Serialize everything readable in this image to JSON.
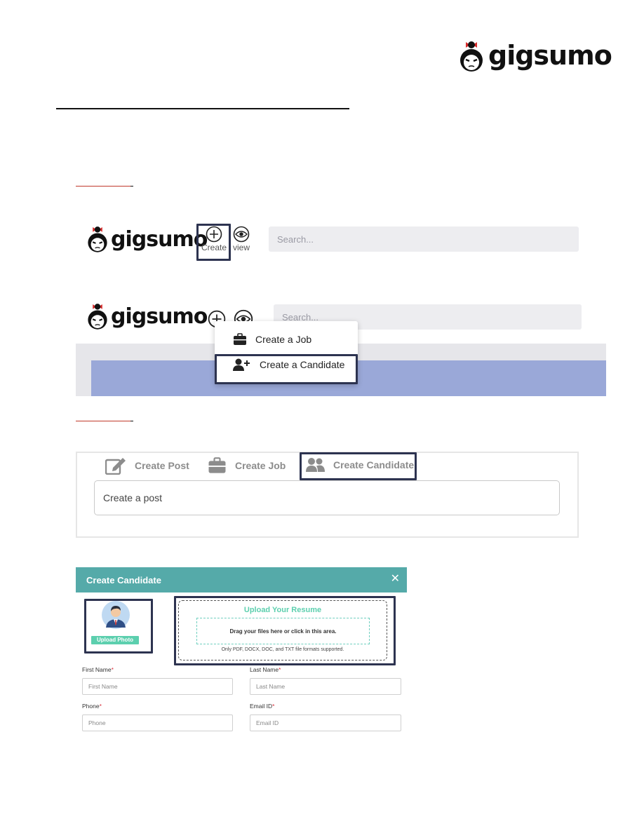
{
  "brand": {
    "name": "gigsumo"
  },
  "screen1": {
    "create_label": "Create",
    "view_label": "view",
    "search_placeholder": "Search..."
  },
  "screen2": {
    "search_placeholder": "Search...",
    "menu": [
      {
        "label": "Create a Job",
        "icon": "briefcase-icon"
      },
      {
        "label": "Create a Candidate",
        "icon": "user-plus-icon"
      }
    ]
  },
  "screen3": {
    "tabs": [
      {
        "label": "Create Post",
        "icon": "edit-icon"
      },
      {
        "label": "Create Job",
        "icon": "briefcase-icon"
      },
      {
        "label": "Create Candidate",
        "icon": "users-icon"
      }
    ],
    "post_placeholder": "Create a post"
  },
  "screen4": {
    "title": "Create Candidate",
    "close": "✕",
    "upload_photo": "Upload Photo",
    "resume_title": "Upload Your Resume",
    "drop_text": "Drag your files here or click in this area.",
    "format_note": "Only PDF, DOCX, DOC, and TXT file formats supported.",
    "fields": {
      "first_name": {
        "label": "First Name",
        "placeholder": "First Name"
      },
      "last_name": {
        "label": "Last Name",
        "placeholder": "Last Name"
      },
      "phone": {
        "label": "Phone",
        "placeholder": "Phone"
      },
      "email": {
        "label": "Email ID",
        "placeholder": "Email ID"
      }
    },
    "required_mark": "*"
  },
  "colors": {
    "highlight_border": "#2d3350",
    "modal_header": "#55aaa9",
    "accent_green": "#5ccfae",
    "banner_blue": "#9aa8d8",
    "underline_red": "#c0392b"
  }
}
